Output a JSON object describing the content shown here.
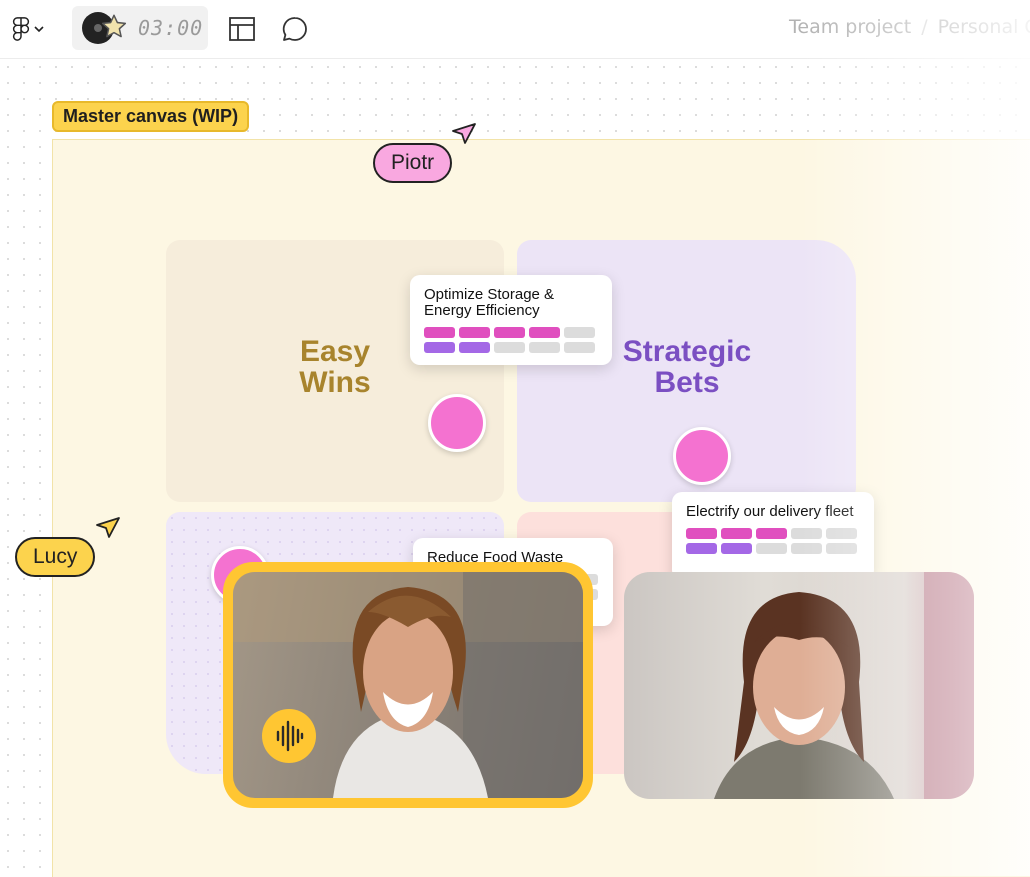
{
  "topbar": {
    "timer": "03:00",
    "breadcrumb": {
      "team": "Team project",
      "separator": "/",
      "page": "Personal C"
    }
  },
  "icons": {
    "logo": "figma-logo-icon",
    "chevron": "chevron-down-icon",
    "layout": "layout-icon",
    "comment": "comment-icon",
    "music": "music-disc-icon",
    "star": "star-icon",
    "audio": "audio-waveform-icon",
    "cursor": "cursor-arrow-icon"
  },
  "canvas": {
    "frame_label": "Master canvas (WIP)"
  },
  "quadrants": {
    "easy": {
      "line1": "Easy",
      "line2": "Wins",
      "color": "#a8842d"
    },
    "strategic": {
      "line1": "Strategic",
      "line2": "Bets",
      "color": "#7b4fc2"
    }
  },
  "cards": [
    {
      "title": "Optimize Storage & Energy Efficiency",
      "row1_filled": 4,
      "row2_filled": 2
    },
    {
      "title": "Electrify our delivery fleet",
      "row1_filled": 3,
      "row2_filled": 2
    },
    {
      "title": "Reduce Food Waste"
    }
  ],
  "collaborators": {
    "piotr": {
      "name": "Piotr",
      "color": "#f9a8e0"
    },
    "lucy": {
      "name": "Lucy",
      "color": "#fcd34d"
    }
  },
  "colors": {
    "bar_pink": "#e04fbf",
    "bar_purple": "#a468e6",
    "bar_empty": "#dcdcdc",
    "speaker_ring": "#ffc632"
  }
}
